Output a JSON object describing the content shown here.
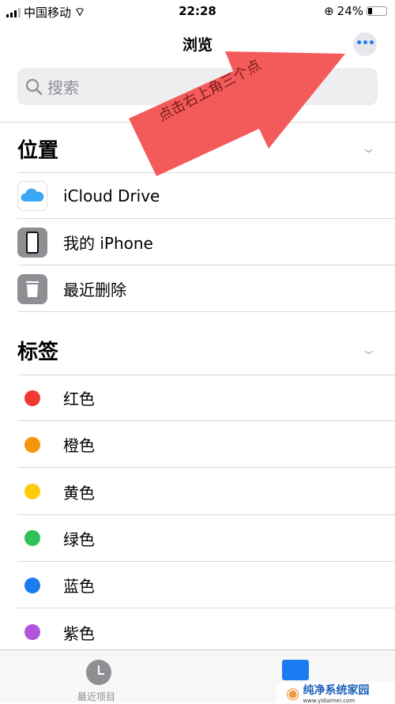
{
  "status": {
    "carrier": "中国移动",
    "time": "22:28",
    "battery": "24%",
    "battery_level": 0.24
  },
  "nav": {
    "title": "浏览",
    "more_icon": "ellipsis-icon",
    "more_label": "•••"
  },
  "search": {
    "placeholder": "搜索"
  },
  "locations": {
    "header": "位置",
    "items": [
      {
        "label": "iCloud Drive",
        "icon": "icloud-icon"
      },
      {
        "label": "我的 iPhone",
        "icon": "iphone-icon"
      },
      {
        "label": "最近删除",
        "icon": "trash-icon"
      }
    ]
  },
  "tags": {
    "header": "标签",
    "items": [
      {
        "label": "红色",
        "color": "#f03a32"
      },
      {
        "label": "橙色",
        "color": "#f5960f"
      },
      {
        "label": "黄色",
        "color": "#fdcc0d"
      },
      {
        "label": "绿色",
        "color": "#30c158"
      },
      {
        "label": "蓝色",
        "color": "#1a7cf0"
      },
      {
        "label": "紫色",
        "color": "#b055dc"
      }
    ]
  },
  "annotation": {
    "text": "点击右上角三个点",
    "color": "#f25252"
  },
  "tabbar": {
    "recents": "最近项目"
  },
  "watermark": {
    "name": "纯净系统家园",
    "url": "www.yidaimei.com"
  }
}
